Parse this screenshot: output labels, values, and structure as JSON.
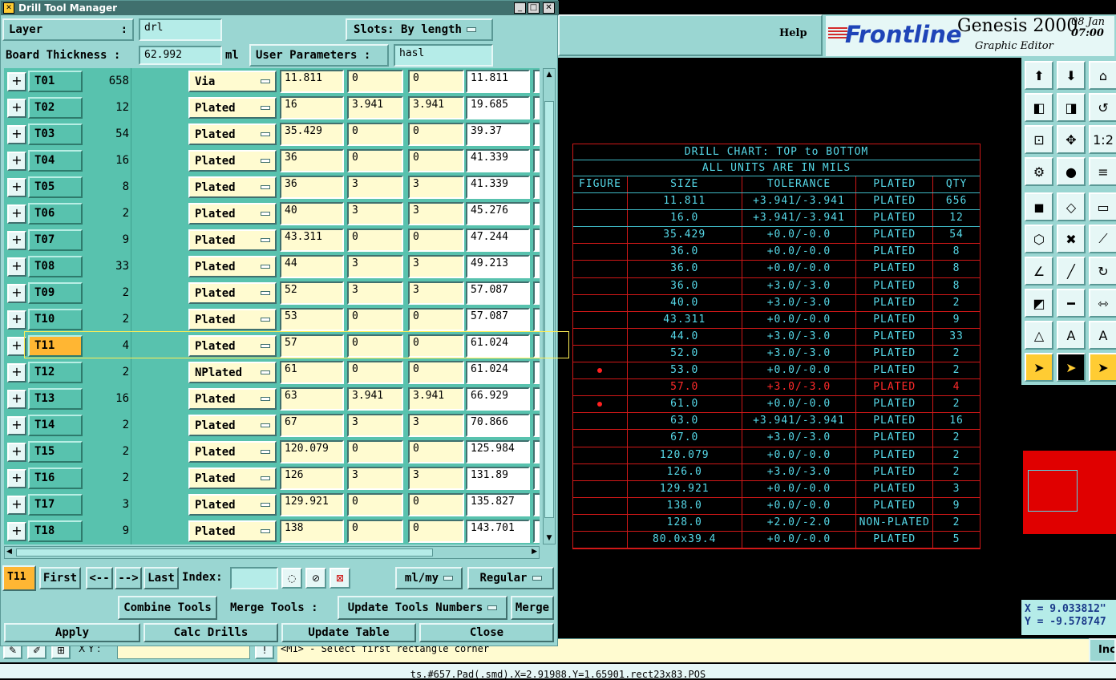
{
  "dialog": {
    "title": "Drill Tool Manager",
    "layer_label": "Layer",
    "layer_colon": ":",
    "layer_value": "drl",
    "slots_label": "Slots:",
    "slots_value": "By length",
    "board_thickness_label": "Board Thickness :",
    "board_thickness_value": "62.992",
    "board_thickness_unit": "ml",
    "user_params_label": "User Parameters :",
    "user_params_value": "hasl",
    "tools": [
      {
        "name": "T01",
        "count": "658",
        "type": "Via",
        "f1": "11.811",
        "f2": "0",
        "f3": "0",
        "f4": "11.811"
      },
      {
        "name": "T02",
        "count": "12",
        "type": "Plated",
        "f1": "16",
        "f2": "3.941",
        "f3": "3.941",
        "f4": "19.685"
      },
      {
        "name": "T03",
        "count": "54",
        "type": "Plated",
        "f1": "35.429",
        "f2": "0",
        "f3": "0",
        "f4": "39.37"
      },
      {
        "name": "T04",
        "count": "16",
        "type": "Plated",
        "f1": "36",
        "f2": "0",
        "f3": "0",
        "f4": "41.339"
      },
      {
        "name": "T05",
        "count": "8",
        "type": "Plated",
        "f1": "36",
        "f2": "3",
        "f3": "3",
        "f4": "41.339"
      },
      {
        "name": "T06",
        "count": "2",
        "type": "Plated",
        "f1": "40",
        "f2": "3",
        "f3": "3",
        "f4": "45.276"
      },
      {
        "name": "T07",
        "count": "9",
        "type": "Plated",
        "f1": "43.311",
        "f2": "0",
        "f3": "0",
        "f4": "47.244"
      },
      {
        "name": "T08",
        "count": "33",
        "type": "Plated",
        "f1": "44",
        "f2": "3",
        "f3": "3",
        "f4": "49.213"
      },
      {
        "name": "T09",
        "count": "2",
        "type": "Plated",
        "f1": "52",
        "f2": "3",
        "f3": "3",
        "f4": "57.087"
      },
      {
        "name": "T10",
        "count": "2",
        "type": "Plated",
        "f1": "53",
        "f2": "0",
        "f3": "0",
        "f4": "57.087"
      },
      {
        "name": "T11",
        "count": "4",
        "type": "Plated",
        "f1": "57",
        "f2": "0",
        "f3": "0",
        "f4": "61.024"
      },
      {
        "name": "T12",
        "count": "2",
        "type": "NPlated",
        "f1": "61",
        "f2": "0",
        "f3": "0",
        "f4": "61.024"
      },
      {
        "name": "T13",
        "count": "16",
        "type": "Plated",
        "f1": "63",
        "f2": "3.941",
        "f3": "3.941",
        "f4": "66.929"
      },
      {
        "name": "T14",
        "count": "2",
        "type": "Plated",
        "f1": "67",
        "f2": "3",
        "f3": "3",
        "f4": "70.866"
      },
      {
        "name": "T15",
        "count": "2",
        "type": "Plated",
        "f1": "120.079",
        "f2": "0",
        "f3": "0",
        "f4": "125.984"
      },
      {
        "name": "T16",
        "count": "2",
        "type": "Plated",
        "f1": "126",
        "f2": "3",
        "f3": "3",
        "f4": "131.89"
      },
      {
        "name": "T17",
        "count": "3",
        "type": "Plated",
        "f1": "129.921",
        "f2": "0",
        "f3": "0",
        "f4": "135.827"
      },
      {
        "name": "T18",
        "count": "9",
        "type": "Plated",
        "f1": "138",
        "f2": "0",
        "f3": "0",
        "f4": "143.701"
      }
    ],
    "selected_tool": "T11",
    "nav": {
      "current": "T11",
      "first": "First",
      "prev": "<--",
      "next": "-->",
      "last": "Last",
      "index_label": "Index:",
      "units": "ml/my",
      "mode": "Regular"
    },
    "combine_tools": "Combine Tools",
    "merge_tools_label": "Merge Tools :",
    "merge_mode": "Update Tools Numbers",
    "merge": "Merge",
    "apply": "Apply",
    "calc_drills": "Calc Drills",
    "update_table": "Update Table",
    "close": "Close"
  },
  "header": {
    "help": "Help",
    "logo": "Frontline",
    "product": "Genesis 2000",
    "subtitle": "Graphic Editor",
    "date": "08 Jan",
    "time": "07:00"
  },
  "drill_chart": {
    "title": "DRILL CHART: TOP to BOTTOM",
    "units": "ALL UNITS ARE IN MILS",
    "headers": [
      "FIGURE",
      "SIZE",
      "TOLERANCE",
      "PLATED",
      "QTY"
    ],
    "rows": [
      {
        "fig": "",
        "size": "11.811",
        "tol": "+3.941/-3.941",
        "plated": "PLATED",
        "qty": "656"
      },
      {
        "fig": "",
        "size": "16.0",
        "tol": "+3.941/-3.941",
        "plated": "PLATED",
        "qty": "12"
      },
      {
        "fig": "",
        "size": "35.429",
        "tol": "+0.0/-0.0",
        "plated": "PLATED",
        "qty": "54"
      },
      {
        "fig": "",
        "size": "36.0",
        "tol": "+0.0/-0.0",
        "plated": "PLATED",
        "qty": "8"
      },
      {
        "fig": "",
        "size": "36.0",
        "tol": "+0.0/-0.0",
        "plated": "PLATED",
        "qty": "8"
      },
      {
        "fig": "",
        "size": "36.0",
        "tol": "+3.0/-3.0",
        "plated": "PLATED",
        "qty": "8"
      },
      {
        "fig": "",
        "size": "40.0",
        "tol": "+3.0/-3.0",
        "plated": "PLATED",
        "qty": "2"
      },
      {
        "fig": "",
        "size": "43.311",
        "tol": "+0.0/-0.0",
        "plated": "PLATED",
        "qty": "9"
      },
      {
        "fig": "",
        "size": "44.0",
        "tol": "+3.0/-3.0",
        "plated": "PLATED",
        "qty": "33"
      },
      {
        "fig": "",
        "size": "52.0",
        "tol": "+3.0/-3.0",
        "plated": "PLATED",
        "qty": "2"
      },
      {
        "fig": "dot",
        "size": "53.0",
        "tol": "+0.0/-0.0",
        "plated": "PLATED",
        "qty": "2"
      },
      {
        "fig": "",
        "size": "57.0",
        "tol": "+3.0/-3.0",
        "plated": "PLATED",
        "qty": "4",
        "highlight": true
      },
      {
        "fig": "dot",
        "size": "61.0",
        "tol": "+0.0/-0.0",
        "plated": "PLATED",
        "qty": "2"
      },
      {
        "fig": "",
        "size": "63.0",
        "tol": "+3.941/-3.941",
        "plated": "PLATED",
        "qty": "16"
      },
      {
        "fig": "",
        "size": "67.0",
        "tol": "+3.0/-3.0",
        "plated": "PLATED",
        "qty": "2"
      },
      {
        "fig": "",
        "size": "120.079",
        "tol": "+0.0/-0.0",
        "plated": "PLATED",
        "qty": "2"
      },
      {
        "fig": "",
        "size": "126.0",
        "tol": "+3.0/-3.0",
        "plated": "PLATED",
        "qty": "2"
      },
      {
        "fig": "",
        "size": "129.921",
        "tol": "+0.0/-0.0",
        "plated": "PLATED",
        "qty": "3"
      },
      {
        "fig": "",
        "size": "138.0",
        "tol": "+0.0/-0.0",
        "plated": "PLATED",
        "qty": "9"
      },
      {
        "fig": "",
        "size": "128.0",
        "tol": "+2.0/-2.0",
        "plated": "NON-PLATED",
        "qty": "2"
      },
      {
        "fig": "",
        "size": "80.0x39.4",
        "tol": "+0.0/-0.0",
        "plated": "PLATED",
        "qty": "5"
      }
    ]
  },
  "coords": {
    "x": "X = 9.033812\"",
    "y": "Y = -9.578747"
  },
  "cmd": {
    "xy_label": "X Y :",
    "message": "<M1> - Select first rectangle corner",
    "inc": "Inc"
  },
  "status_line": "ts.#657.Pad(.smd).X=2.91988.Y=1.65901.rect23x83.POS",
  "colors": {
    "panel": "#9ad6d2",
    "table_bg": "#58c2ae",
    "field": "#fffbd0",
    "chart_cyan": "#56d8e8",
    "chart_red": "#d01818",
    "selected": "#ffb633"
  }
}
